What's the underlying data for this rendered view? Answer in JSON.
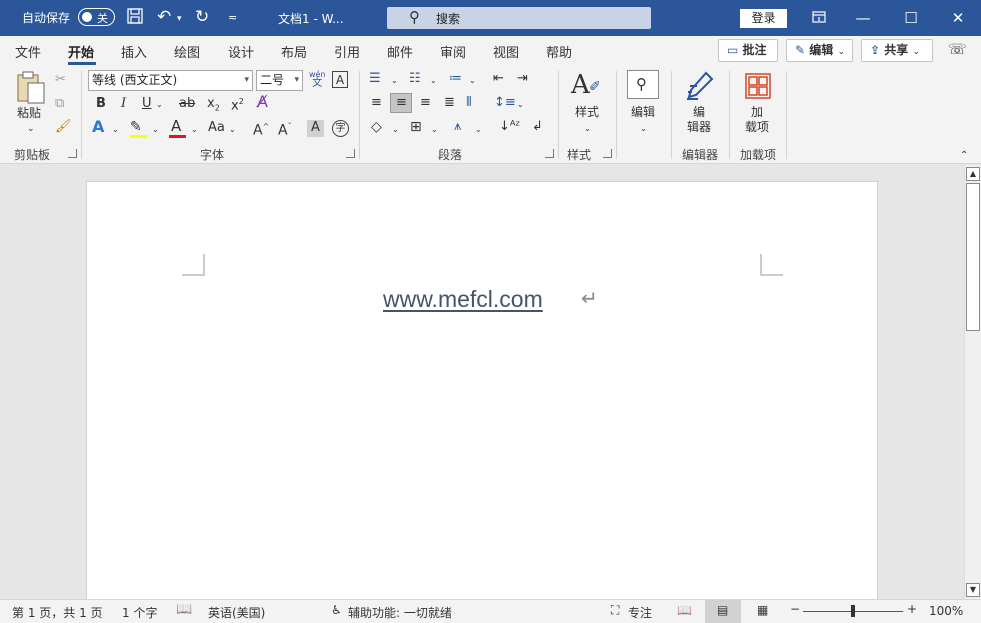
{
  "titlebar": {
    "autosave_label": "自动保存",
    "autosave_state": "关",
    "doc_title": "文档1  -  W...",
    "search_placeholder": "搜索",
    "login_label": "登录"
  },
  "tabs": [
    {
      "label": "文件"
    },
    {
      "label": "开始"
    },
    {
      "label": "插入"
    },
    {
      "label": "绘图"
    },
    {
      "label": "设计"
    },
    {
      "label": "布局"
    },
    {
      "label": "引用"
    },
    {
      "label": "邮件"
    },
    {
      "label": "审阅"
    },
    {
      "label": "视图"
    },
    {
      "label": "帮助"
    }
  ],
  "ribbon_actions": {
    "comments_label": "批注",
    "edit_label": "编辑",
    "share_label": "共享"
  },
  "ribbon": {
    "paste_label": "粘贴",
    "font_name": "等线 (西文正文)",
    "font_size": "二号",
    "phonetic_top": "wén",
    "phonetic_bottom": "文",
    "styles_label": "样式",
    "editing_label": "编辑",
    "editor_label_1": "编",
    "editor_label_2": "辑器",
    "addins_label_1": "加",
    "addins_label_2": "载项",
    "groups": {
      "clipboard": "剪贴板",
      "font": "字体",
      "paragraph": "段落",
      "styles": "样式",
      "editor": "编辑器",
      "addins": "加载项"
    }
  },
  "document": {
    "text": "www.mefcl.com"
  },
  "statusbar": {
    "page_info": "第 1 页，共 1 页",
    "word_count": "1 个字",
    "language": "英语(美国)",
    "accessibility": "辅助功能: 一切就绪",
    "focus_label": "专注",
    "zoom_label": "100%"
  },
  "colors": {
    "title_bar": "#2b579a",
    "highlight": "#ffff00",
    "font_color": "#e81123",
    "doc_text": "#44546a"
  }
}
